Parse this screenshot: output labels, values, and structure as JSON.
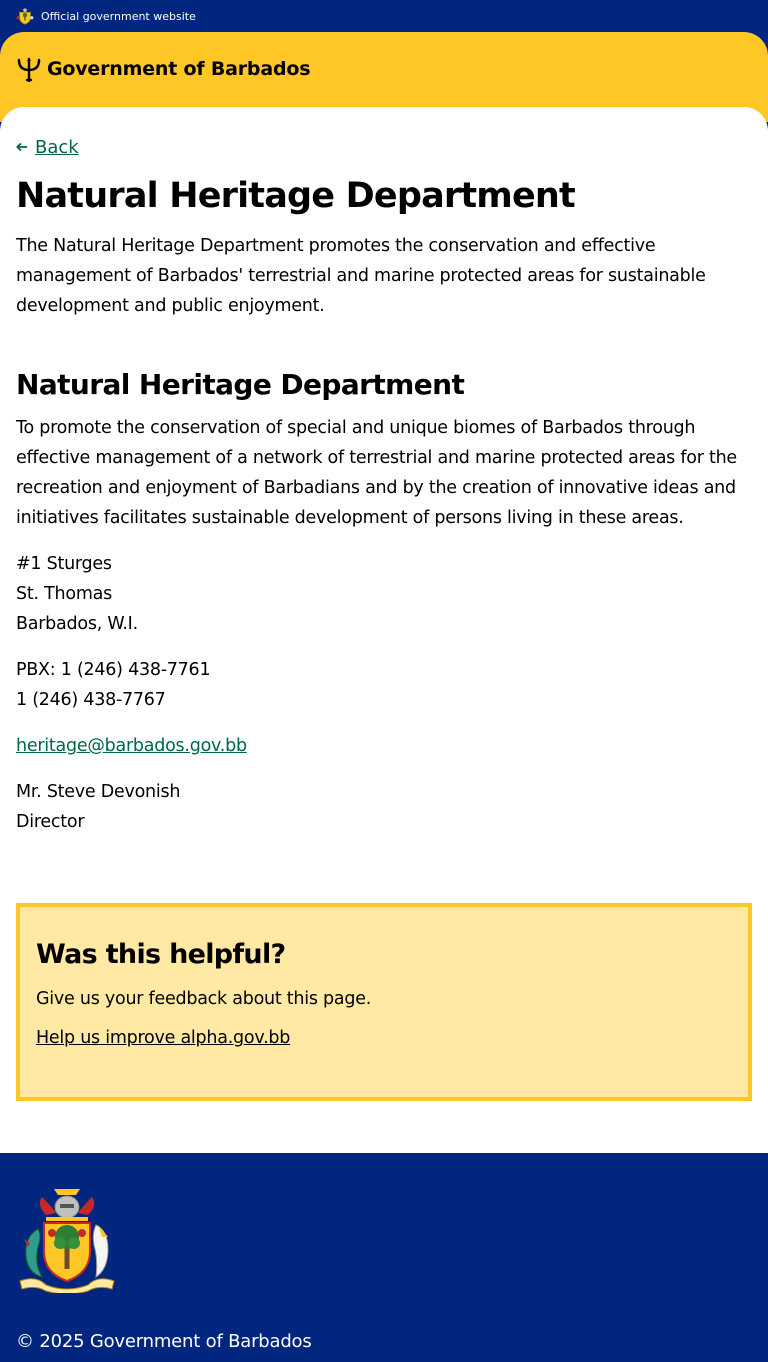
{
  "topbar": {
    "label": "Official government website"
  },
  "header": {
    "title": "Government of Barbados"
  },
  "nav": {
    "back_label": "Back"
  },
  "page": {
    "title": "Natural Heritage Department",
    "intro": "The Natural Heritage Department promotes the conservation and effective management of Barbados' terrestrial and marine protected areas for sustainable development and public enjoyment.",
    "section_title": "Natural Heritage Department",
    "mission": "To promote the conservation of special and unique biomes of Barbados through effective management of a network of terrestrial and marine protected areas for the recreation and enjoyment of Barbadians and by the creation of innovative ideas and initiatives facilitates sustainable development of persons living in these areas.",
    "address": [
      "#1 Sturges",
      "St. Thomas",
      "Barbados, W.I."
    ],
    "phones": [
      "PBX: 1 (246) 438-7761",
      "1 (246) 438-7767"
    ],
    "email": "heritage@barbados.gov.bb",
    "contact_name": "Mr. Steve Devonish",
    "contact_role": "Director"
  },
  "feedback": {
    "title": "Was this helpful?",
    "text": "Give us your feedback about this page.",
    "link": "Help us improve alpha.gov.bb"
  },
  "footer": {
    "copyright": "© 2025 Government of Barbados"
  },
  "icons": {
    "crest": "coat-of-arms-icon",
    "trident": "trident-icon",
    "back": "arrow-left-icon"
  },
  "colors": {
    "navy": "#00267f",
    "gold": "#ffc726",
    "pale_gold": "#ffe9a5",
    "link_green": "#00654a"
  }
}
